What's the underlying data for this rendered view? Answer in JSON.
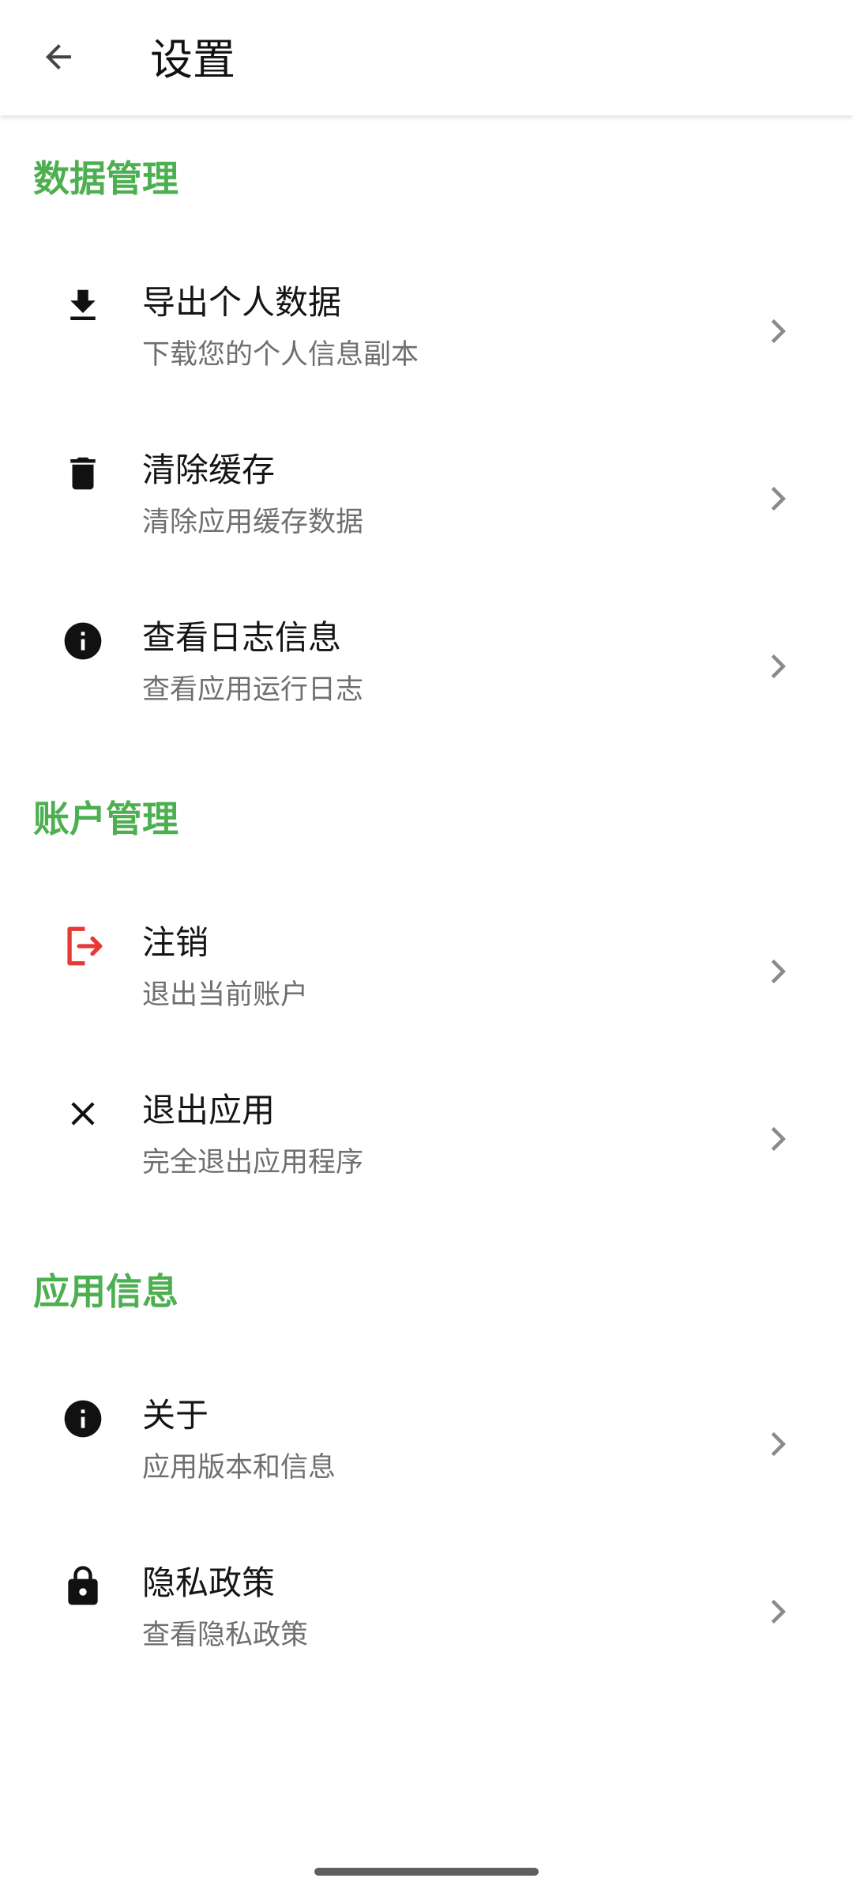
{
  "app_bar": {
    "title": "设置",
    "back_icon": "arrow-back-icon"
  },
  "colors": {
    "section_header": "#4caf50",
    "logout_icon": "#e53935",
    "icon_default": "#111111",
    "chevron": "#8a8a8a"
  },
  "sections": [
    {
      "title": "数据管理",
      "items": [
        {
          "title": "导出个人数据",
          "subtitle": "下载您的个人信息副本",
          "icon": "download-icon"
        },
        {
          "title": "清除缓存",
          "subtitle": "清除应用缓存数据",
          "icon": "trash-icon"
        },
        {
          "title": "查看日志信息",
          "subtitle": "查看应用运行日志",
          "icon": "info-icon"
        }
      ]
    },
    {
      "title": "账户管理",
      "items": [
        {
          "title": "注销",
          "subtitle": "退出当前账户",
          "icon": "logout-icon"
        },
        {
          "title": "退出应用",
          "subtitle": "完全退出应用程序",
          "icon": "close-icon"
        }
      ]
    },
    {
      "title": "应用信息",
      "items": [
        {
          "title": "关于",
          "subtitle": "应用版本和信息",
          "icon": "info-icon"
        },
        {
          "title": "隐私政策",
          "subtitle": "查看隐私政策",
          "icon": "lock-icon"
        }
      ]
    }
  ]
}
